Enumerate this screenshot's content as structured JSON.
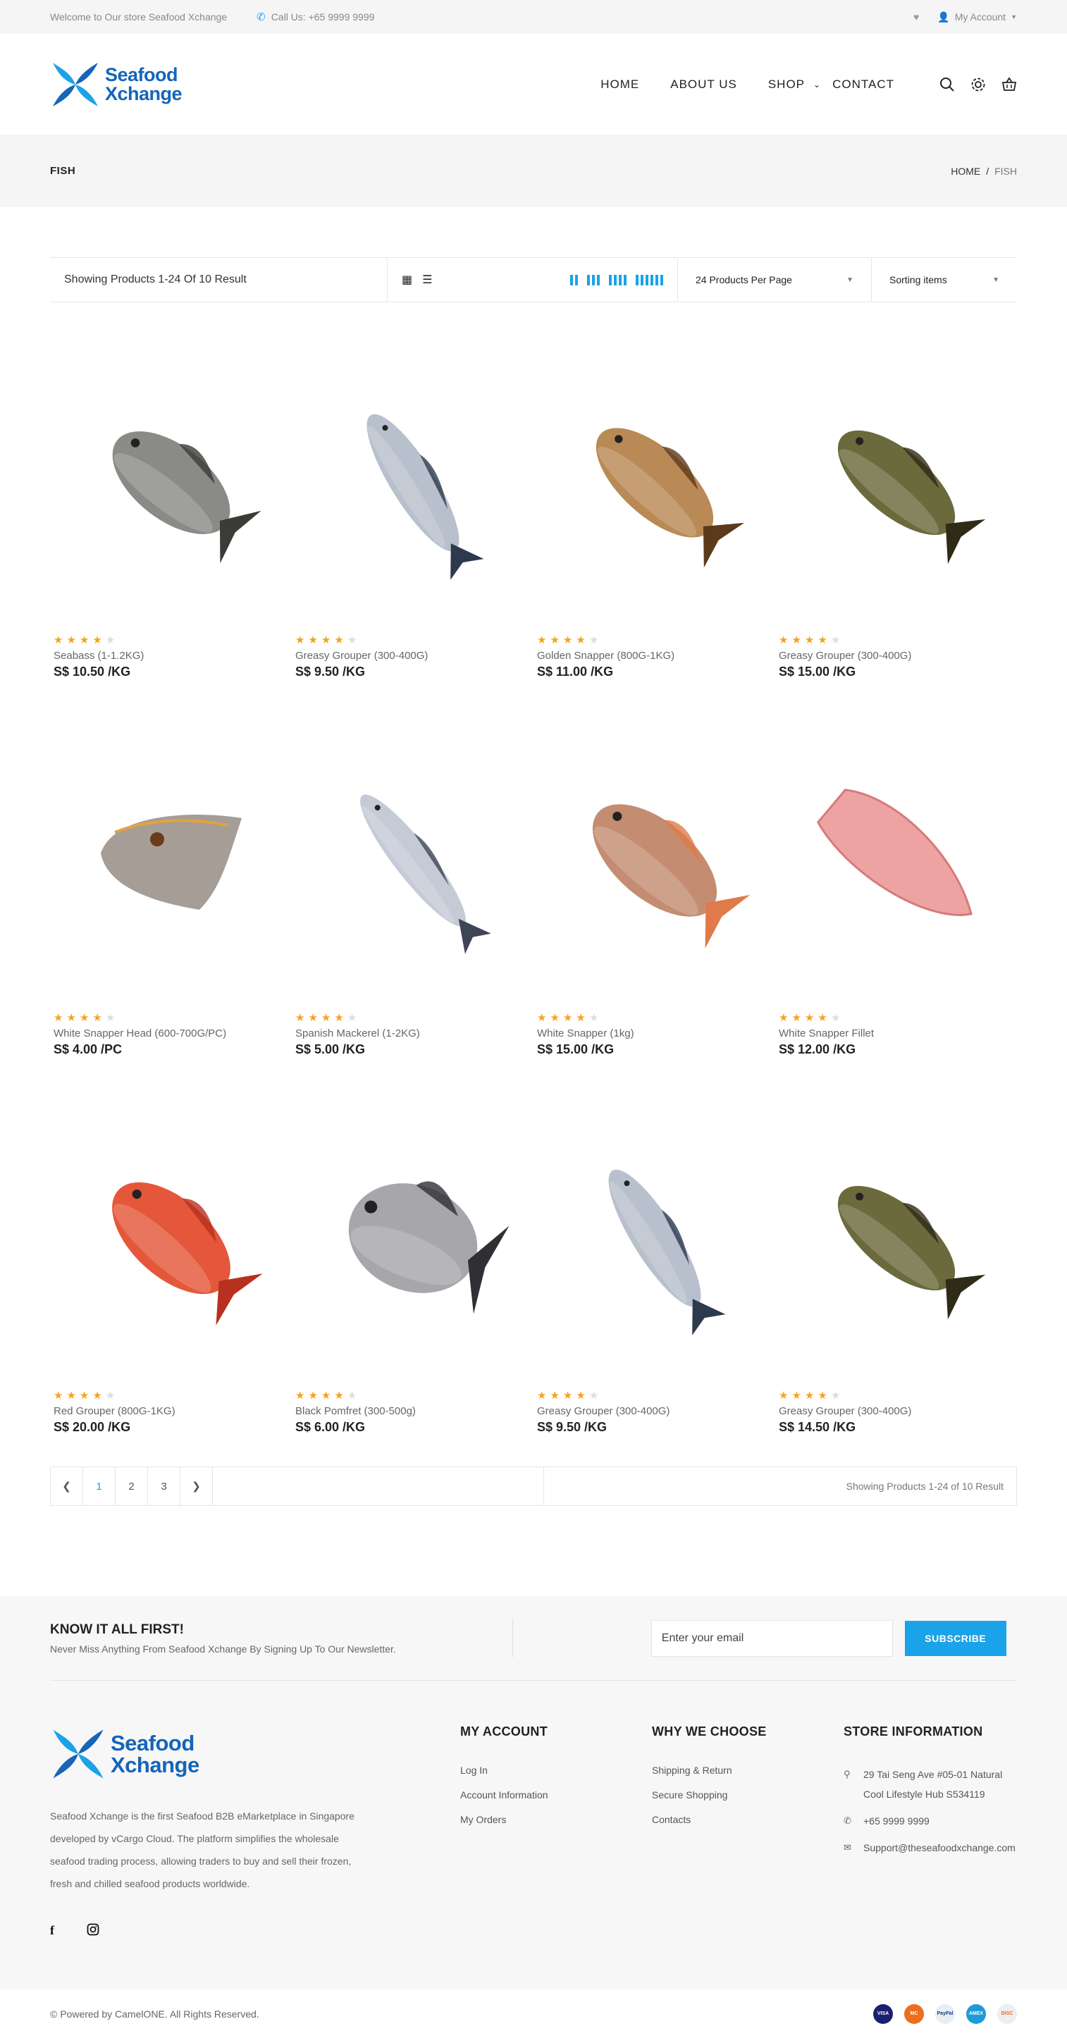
{
  "topbar": {
    "welcome": "Welcome to Our store Seafood Xchange",
    "call": "Call Us: +65 9999 9999",
    "account": "My Account"
  },
  "logo": {
    "line1": "Seafood",
    "line2": "Xchange",
    "brand_color": "#1565b8"
  },
  "nav": {
    "items": [
      "HOME",
      "ABOUT US",
      "SHOP",
      "CONTACT"
    ]
  },
  "breadcrumb": {
    "title": "FISH",
    "home": "HOME",
    "sep": "/",
    "current": "FISH"
  },
  "toolbar": {
    "count": "Showing Products 1-24 Of 10 Result",
    "per_page": "24 Products Per Page",
    "sort": "Sorting items"
  },
  "products": [
    {
      "name": "Seabass (1-1.2KG)",
      "price": "S$ 10.50 /KG",
      "rating": 4
    },
    {
      "name": "Greasy Grouper (300-400G)",
      "price": "S$ 9.50 /KG",
      "rating": 4
    },
    {
      "name": "Golden Snapper (800G-1KG)",
      "price": "S$ 11.00 /KG",
      "rating": 4
    },
    {
      "name": "Greasy Grouper (300-400G)",
      "price": "S$ 15.00 /KG",
      "rating": 4
    },
    {
      "name": "White Snapper Head (600-700G/PC)",
      "price": "S$ 4.00 /PC",
      "rating": 4
    },
    {
      "name": "Spanish Mackerel (1-2KG)",
      "price": "S$ 5.00 /KG",
      "rating": 4
    },
    {
      "name": "White Snapper (1kg)",
      "price": "S$ 15.00 /KG",
      "rating": 4
    },
    {
      "name": "White Snapper Fillet",
      "price": "S$ 12.00 /KG",
      "rating": 4
    },
    {
      "name": "Red Grouper (800G-1KG)",
      "price": "S$ 20.00 /KG",
      "rating": 4
    },
    {
      "name": "Black Pomfret (300-500g)",
      "price": "S$ 6.00 /KG",
      "rating": 4
    },
    {
      "name": "Greasy Grouper (300-400G)",
      "price": "S$ 9.50 /KG",
      "rating": 4
    },
    {
      "name": "Greasy Grouper (300-400G)",
      "price": "S$ 14.50 /KG",
      "rating": 4
    }
  ],
  "pagination": {
    "pages": [
      "1",
      "2",
      "3"
    ],
    "info": "Showing Products 1-24 of 10 Result"
  },
  "newsletter": {
    "title": "KNOW IT ALL FIRST!",
    "subtitle": "Never Miss Anything From Seafood Xchange By Signing Up To Our Newsletter.",
    "placeholder": "Enter your email",
    "button": "SUBSCRIBE"
  },
  "footer": {
    "about": "Seafood Xchange is the first Seafood B2B eMarketplace in Singapore developed by vCargo Cloud. The platform simplifies the wholesale seafood trading process, allowing traders to buy and sell their frozen, fresh and chilled seafood products worldwide.",
    "my_account": {
      "title": "MY ACCOUNT",
      "links": [
        "Log In",
        "Account Information",
        "My Orders"
      ]
    },
    "why": {
      "title": "WHY WE CHOOSE",
      "links": [
        "Shipping & Return",
        "Secure Shopping",
        "Contacts"
      ]
    },
    "store": {
      "title": "STORE INFORMATION",
      "address": "29 Tai Seng Ave #05-01 Natural Cool Lifestyle Hub S534119",
      "phone": "+65 9999 9999",
      "email": "Support@theseafoodxchange.com"
    },
    "copyright": "© Powered by CamelONE. All Rights Reserved.",
    "payments": [
      "VISA",
      "MC",
      "PayPal",
      "AMEX",
      "DISC"
    ]
  },
  "colors": {
    "accent": "#1aa3e8",
    "star": "#f7a21b"
  }
}
